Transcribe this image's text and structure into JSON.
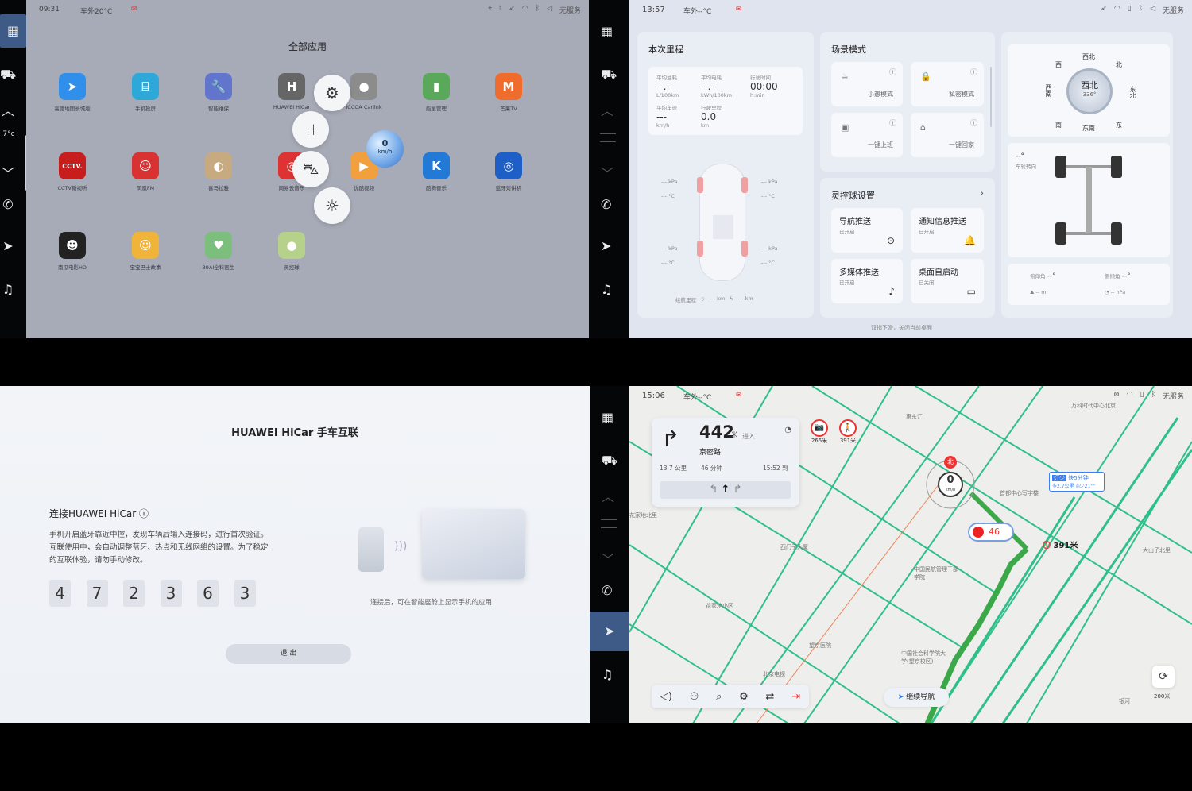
{
  "rail": {
    "icons": [
      "grid-icon",
      "car-icon",
      "chevron-up-icon",
      "chevron-down-icon",
      "phone-icon",
      "navigation-icon",
      "music-icon"
    ],
    "temp_left": "7°c",
    "temp_right": "– –"
  },
  "p1": {
    "status": {
      "time": "09:31",
      "temp": "车外20°C"
    },
    "title": "全部应用",
    "apps": [
      {
        "label": "高德地图长城版",
        "color": "#2f8fea",
        "glyph": "➤"
      },
      {
        "label": "手机投屏",
        "color": "#2ea8d8",
        "glyph": "⌸"
      },
      {
        "label": "智能维保",
        "color": "#6275cc",
        "glyph": "🔧"
      },
      {
        "label": "HUAWEI HiCar",
        "color": "#666",
        "glyph": "H"
      },
      {
        "label": "ICCOA Carlink",
        "color": "#8c8c8c",
        "glyph": "●"
      },
      {
        "label": "能量管理",
        "color": "#5aa85a",
        "glyph": "▮"
      },
      {
        "label": "芒果TV",
        "color": "#f06c2c",
        "glyph": "M"
      },
      {
        "label": "CCTV新视听",
        "color": "#c81d1d",
        "glyph": "CCTV."
      },
      {
        "label": "凤凰FM",
        "color": "#d83232",
        "glyph": "☺"
      },
      {
        "label": "喜马拉雅",
        "color": "#c8aa80",
        "glyph": "◐"
      },
      {
        "label": "网易云音乐",
        "color": "#d33",
        "glyph": "◎"
      },
      {
        "label": "优酷视频",
        "color": "#f2a03d",
        "glyph": "▶"
      },
      {
        "label": "酷狗音乐",
        "color": "#2379d6",
        "glyph": "K"
      },
      {
        "label": "蓝牙对讲机",
        "color": "#1d5fc6",
        "glyph": "◎"
      },
      {
        "label": "南瓜电影HD",
        "color": "#222",
        "glyph": "☻"
      },
      {
        "label": "宝宝巴士故事",
        "color": "#f0b43a",
        "glyph": "☺"
      },
      {
        "label": "39AI全科医生",
        "color": "#7cbf7c",
        "glyph": "♥"
      },
      {
        "label": "灵控球",
        "color": "#b6d28a",
        "glyph": "●"
      }
    ],
    "speed_unit": "km/h",
    "speed_value": "0"
  },
  "p2": {
    "status": {
      "time": "13:57",
      "temp": "车外--°C",
      "service": "无服务"
    },
    "trip": {
      "title": "本次里程",
      "avg_fuel_label": "平均油耗",
      "avg_fuel_value": "--.-",
      "avg_fuel_unit": "L/100km",
      "avg_power_label": "平均电耗",
      "avg_power_value": "--.-",
      "avg_power_unit": "kWh/100km",
      "drive_time_label": "行驶时间",
      "drive_time_value": "00:00",
      "drive_time_unit": "h:min",
      "avg_speed_label": "平均车速",
      "avg_speed_value": "---",
      "avg_speed_unit": "km/h",
      "drive_dist_label": "行驶里程",
      "drive_dist_value": "0.0",
      "drive_dist_unit": "km",
      "tire_kpa": "--- kPa",
      "tire_c": "--- °C",
      "range_label": "续航里程",
      "range_fuel": "--- km",
      "range_elec": "--- km"
    },
    "scene": {
      "title": "场景模式",
      "modes": [
        "小憩模式",
        "私密模式",
        "一键上班",
        "一键回家"
      ]
    },
    "ball": {
      "title": "灵控球设置",
      "items": [
        {
          "label": "导航推送",
          "state": "已开启"
        },
        {
          "label": "通知信息推送",
          "state": "已开启"
        },
        {
          "label": "多媒体推送",
          "state": "已开启"
        },
        {
          "label": "桌面自启动",
          "state": "已关闭"
        }
      ],
      "footer": "双指下滑，关闭当前桌面"
    },
    "compass": {
      "center": "西北",
      "deg": "336°",
      "dirs": [
        "西北",
        "北",
        "东北",
        "东",
        "东南",
        "南",
        "西南",
        "西"
      ]
    },
    "steer_label": "车轮转向",
    "steer_value": "--°",
    "pitch_label": "俯仰角",
    "pitch_value": "--°",
    "roll_label": "侧倾角",
    "roll_value": "--°",
    "alt_value": "-- m",
    "press_value": "-- hPa"
  },
  "p3": {
    "title": "HUAWEI HiCar 手车互联",
    "connect_title": "连接HUAWEI HiCar ⓘ",
    "desc1": "手机开启蓝牙靠近中控，发现车辆后输入连接码，进行首次验证。",
    "desc2": "互联使用中，会自动调整蓝牙、热点和无线网络的设置。为了稳定",
    "desc3": "的互联体验，请勿手动修改。",
    "code": [
      "4",
      "7",
      "2",
      "3",
      "6",
      "3"
    ],
    "caption": "连接后，可在智能座舱上显示手机的应用",
    "exit": "退 出"
  },
  "p4": {
    "status": {
      "time": "15:06",
      "temp": "车外--°C",
      "service": "无服务"
    },
    "nav": {
      "distance": "442",
      "unit": "米",
      "enter": "进入",
      "road": "京密路",
      "remain_km": "13.7 公里",
      "remain_min": "46 分钟",
      "eta": "15:52 到"
    },
    "cams": [
      "265米",
      "391米"
    ],
    "speed": "0",
    "speed_unit": "km/h",
    "limit": "46",
    "ped_dist": "391米",
    "route_tag1": "灯少",
    "route_tag2": "快5分钟",
    "route_tag3": "多2.7公里 ◎少21个",
    "north": "北",
    "labels": [
      "万科时代中心北京",
      "惠东汇",
      "中国民航管理干部学院",
      "花家地北里",
      "花家地小区",
      "西门子大厦",
      "大山子北里",
      "北京电视",
      "望京医院",
      "中国社会科学院大学(望京校区)",
      "首都中心写字楼",
      "银河"
    ],
    "continue": "继续导航",
    "scale": "200米"
  }
}
